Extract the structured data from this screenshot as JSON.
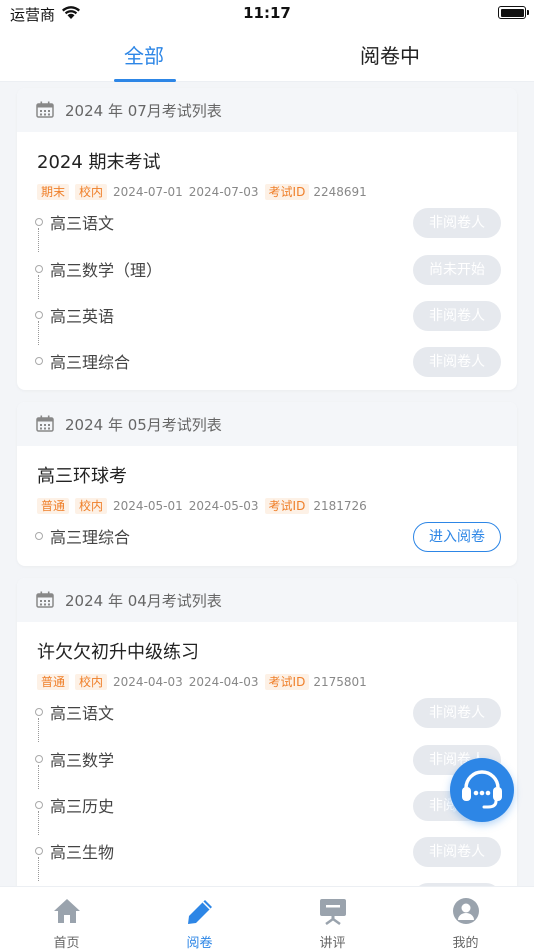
{
  "status": {
    "carrier": "运营商",
    "time": "11:17"
  },
  "tabs": {
    "all": "全部",
    "reading": "阅卷中"
  },
  "exam_id_label": "考试ID",
  "sections": [
    {
      "title": "2024 年 07月考试列表",
      "exam_name": "2024 期末考试",
      "tags": [
        "期末",
        "校内"
      ],
      "start_date": "2024-07-01",
      "end_date": "2024-07-03",
      "exam_id": "2248691",
      "subjects": [
        {
          "name": "高三语文",
          "status": "非阅卷人"
        },
        {
          "name": "高三数学（理）",
          "status": "尚未开始"
        },
        {
          "name": "高三英语",
          "status": "非阅卷人"
        },
        {
          "name": "高三理综合",
          "status": "非阅卷人"
        }
      ]
    },
    {
      "title": "2024 年 05月考试列表",
      "exam_name": "高三环球考",
      "tags": [
        "普通",
        "校内"
      ],
      "start_date": "2024-05-01",
      "end_date": "2024-05-03",
      "exam_id": "2181726",
      "subjects": [
        {
          "name": "高三理综合",
          "status": "进入阅卷"
        }
      ]
    },
    {
      "title": "2024 年 04月考试列表",
      "exam_name": "许欠欠初升中级练习",
      "tags": [
        "普通",
        "校内"
      ],
      "start_date": "2024-04-03",
      "end_date": "2024-04-03",
      "exam_id": "2175801",
      "subjects": [
        {
          "name": "高三语文",
          "status": "非阅卷人"
        },
        {
          "name": "高三数学",
          "status": "非阅卷人"
        },
        {
          "name": "高三历史",
          "status": "非阅卷人"
        },
        {
          "name": "高三生物",
          "status": "非阅卷人"
        }
      ]
    }
  ],
  "tabbar": {
    "home": "首页",
    "reading": "阅卷",
    "lecture": "讲评",
    "mine": "我的"
  },
  "colors": {
    "accent": "#2d86e6",
    "tag_text": "#ef7f29",
    "tag_bg": "#fdf1e6",
    "disabled_btn": "#e6e9ee"
  }
}
